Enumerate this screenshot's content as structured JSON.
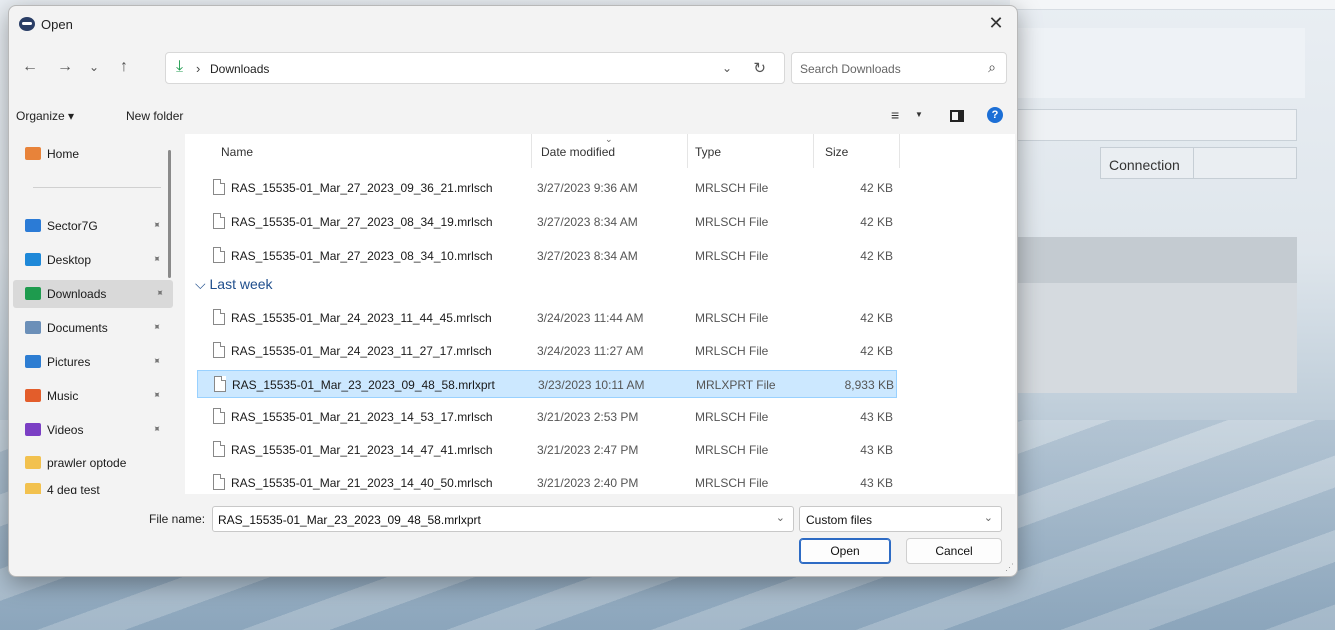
{
  "background_app": {
    "connection_label": "Connection"
  },
  "dialog": {
    "title": "Open",
    "close_glyph": "✕",
    "nav": {
      "back": "←",
      "forward": "→",
      "recent": "⌄",
      "up": "↑"
    },
    "address": {
      "separator": "›",
      "current": "Downloads"
    },
    "search": {
      "placeholder": "Search Downloads"
    },
    "toolbar": {
      "organize": "Organize ▾",
      "new_folder": "New folder",
      "help": "?"
    },
    "nav_pane": {
      "items": [
        {
          "label": "Home",
          "icon": "home-icon",
          "color": "#e8833a"
        },
        {
          "label": "Sector7G",
          "icon": "desktop-monitor-icon",
          "color": "#2b7bd6",
          "pinned": true
        },
        {
          "label": "Desktop",
          "icon": "desktop-icon",
          "color": "#1e88d8",
          "pinned": true
        },
        {
          "label": "Downloads",
          "icon": "download-icon",
          "color": "#1e9b4e",
          "pinned": true,
          "selected": true
        },
        {
          "label": "Documents",
          "icon": "documents-icon",
          "color": "#6b8fb8",
          "pinned": true
        },
        {
          "label": "Pictures",
          "icon": "pictures-icon",
          "color": "#2d7dd2",
          "pinned": true
        },
        {
          "label": "Music",
          "icon": "music-icon",
          "color": "#e35d2b",
          "pinned": true
        },
        {
          "label": "Videos",
          "icon": "videos-icon",
          "color": "#7b3fc4",
          "pinned": true
        },
        {
          "label": "prawler optode",
          "icon": "folder-icon",
          "color": "#f2c14e"
        },
        {
          "label": "4 deg test",
          "icon": "folder-icon",
          "color": "#f2c14e"
        }
      ]
    },
    "columns": {
      "name": "Name",
      "date": "Date modified",
      "type": "Type",
      "size": "Size"
    },
    "group_last_week": "Last week",
    "files_recent": [
      {
        "name": "RAS_15535-01_Mar_27_2023_09_36_21.mrlsch",
        "date": "3/27/2023 9:36 AM",
        "type": "MRLSCH File",
        "size": "42 KB"
      },
      {
        "name": "RAS_15535-01_Mar_27_2023_08_34_19.mrlsch",
        "date": "3/27/2023 8:34 AM",
        "type": "MRLSCH File",
        "size": "42 KB"
      },
      {
        "name": "RAS_15535-01_Mar_27_2023_08_34_10.mrlsch",
        "date": "3/27/2023 8:34 AM",
        "type": "MRLSCH File",
        "size": "42 KB"
      }
    ],
    "files_last_week": [
      {
        "name": "RAS_15535-01_Mar_24_2023_11_44_45.mrlsch",
        "date": "3/24/2023 11:44 AM",
        "type": "MRLSCH File",
        "size": "42 KB"
      },
      {
        "name": "RAS_15535-01_Mar_24_2023_11_27_17.mrlsch",
        "date": "3/24/2023 11:27 AM",
        "type": "MRLSCH File",
        "size": "42 KB"
      },
      {
        "name": "RAS_15535-01_Mar_23_2023_09_48_58.mrlxprt",
        "date": "3/23/2023 10:11 AM",
        "type": "MRLXPRT File",
        "size": "8,933 KB",
        "selected": true
      },
      {
        "name": "RAS_15535-01_Mar_21_2023_14_53_17.mrlsch",
        "date": "3/21/2023 2:53 PM",
        "type": "MRLSCH File",
        "size": "43 KB"
      },
      {
        "name": "RAS_15535-01_Mar_21_2023_14_47_41.mrlsch",
        "date": "3/21/2023 2:47 PM",
        "type": "MRLSCH File",
        "size": "43 KB"
      },
      {
        "name": "RAS_15535-01_Mar_21_2023_14_40_50.mrlsch",
        "date": "3/21/2023 2:40 PM",
        "type": "MRLSCH File",
        "size": "43 KB"
      }
    ],
    "footer": {
      "file_name_label": "File name:",
      "file_name_value": "RAS_15535-01_Mar_23_2023_09_48_58.mrlxprt",
      "filter": "Custom files",
      "open_button": "Open",
      "cancel_button": "Cancel"
    }
  }
}
